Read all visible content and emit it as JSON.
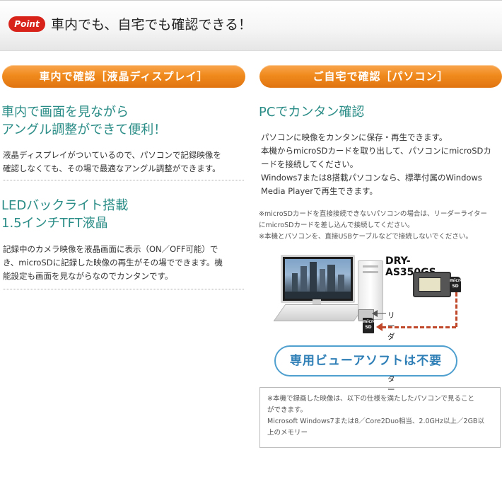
{
  "header": {
    "badge": "Point",
    "title": "車内でも、自宅でも確認できる！"
  },
  "left": {
    "pill": "車内で確認［液晶ディスプレイ］",
    "section1": {
      "heading_line1": "車内で画面を見ながら",
      "heading_line2": "アングル調整ができて便利！",
      "body_line1": "液晶ディスプレイがついているので、パソコンで記録映像を",
      "body_line2": "確認しなくても、その場で最適なアングル調整ができます。"
    },
    "section2": {
      "heading_line1": "LEDバックライト搭載",
      "heading_line2": "1.5インチTFT液晶",
      "body_line1": "記録中のカメラ映像を液晶画面に表示（ON／OFF可能）で",
      "body_line2": "き、microSDに記録した映像の再生がその場でできます。機",
      "body_line3": "能設定も画面を見ながらなのでカンタンです。"
    }
  },
  "right": {
    "pill": "ご自宅で確認［パソコン］",
    "heading": "PCでカンタン確認",
    "body_line1": "パソコンに映像をカンタンに保存・再生できます。",
    "body_line2": "本機からmicroSDカードを取り出して、パソコンにmicroSDカ",
    "body_line3": "ードを接続してください。",
    "body_line4": "Windows7または8搭載パソコンなら、標準付属のWindows",
    "body_line5": "Media Playerで再生できます。",
    "note_line1": "※microSDカードを直接接続できないパソコンの場合は、リーダーライター",
    "note_line2": "にmicroSDカードを差し込んで接続してください。",
    "note_line3": "※本機とパソコンを、直接USBケーブルなどで接続しないでください。",
    "diagram": {
      "model": "DRY-AS350GS",
      "sd_label_top": "micro",
      "sd_label_bottom": "SD",
      "reader_label": "リーダーライター",
      "arrow_color": "#c0492c"
    },
    "soft_button": "専用ビューアソフトは不要",
    "spec": {
      "line1": "※本機で録画した映像は、以下の仕様を満たしたパソコンで見ること",
      "line2": "ができます。",
      "line3": "Microsoft Windows7または8／Core2Duo相当、2.0GHz以上／2GB以",
      "line4": "上のメモリー"
    }
  },
  "colors": {
    "accent_orange": "#f08a1d",
    "teal": "#2a8c86",
    "badge_red": "#d8231b",
    "button_blue": "#2f7fb7"
  }
}
